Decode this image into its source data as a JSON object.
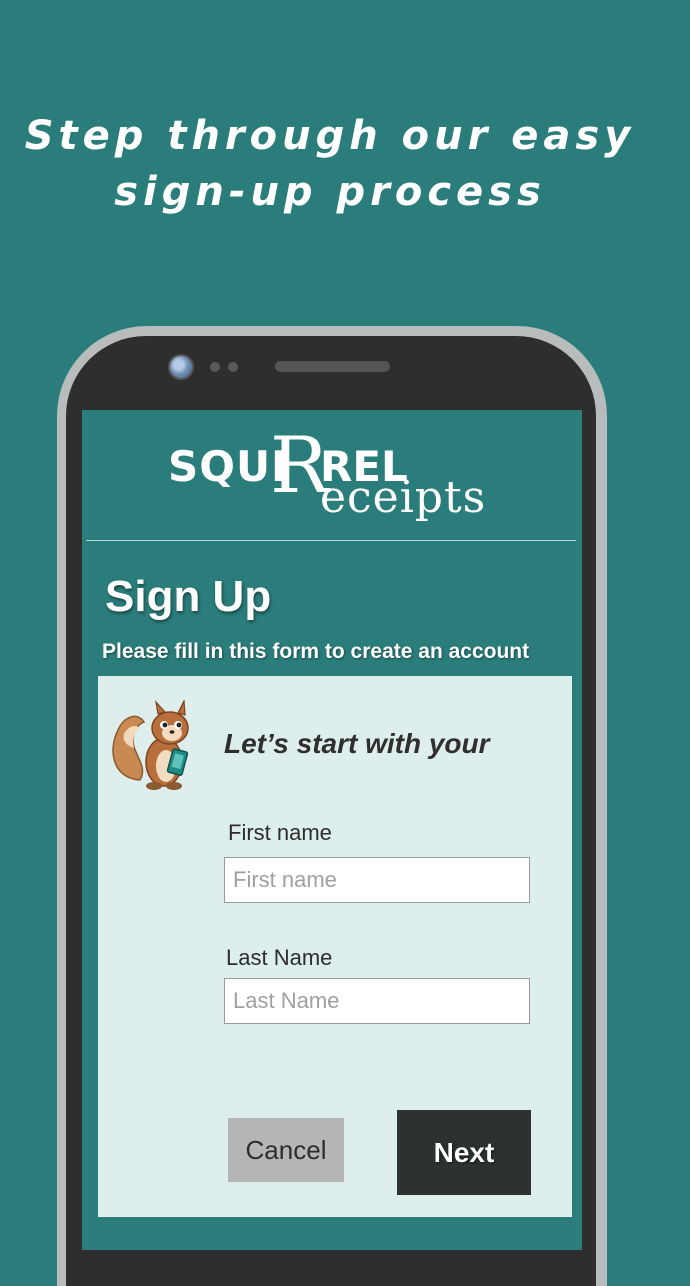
{
  "headline": {
    "line1": "Step through our easy",
    "line2": "sign-up process"
  },
  "logo": {
    "part1": "SQUI",
    "part2": "R",
    "part3": "REL",
    "part4": "eceipts"
  },
  "form": {
    "title": "Sign Up",
    "subtitle": "Please fill in this form to create an account",
    "intro": "Let’s start with your",
    "first_name": {
      "label": "First name",
      "placeholder": "First name",
      "value": ""
    },
    "last_name": {
      "label": "Last Name",
      "placeholder": "Last Name",
      "value": ""
    },
    "cancel_label": "Cancel",
    "next_label": "Next"
  },
  "colors": {
    "background": "#2a7d7b",
    "card": "#ddeeed",
    "next_button": "#2b3230",
    "cancel_button": "#b5b5b5"
  },
  "icons": [
    "phone-camera-icon",
    "squirrel-mascot-icon"
  ]
}
